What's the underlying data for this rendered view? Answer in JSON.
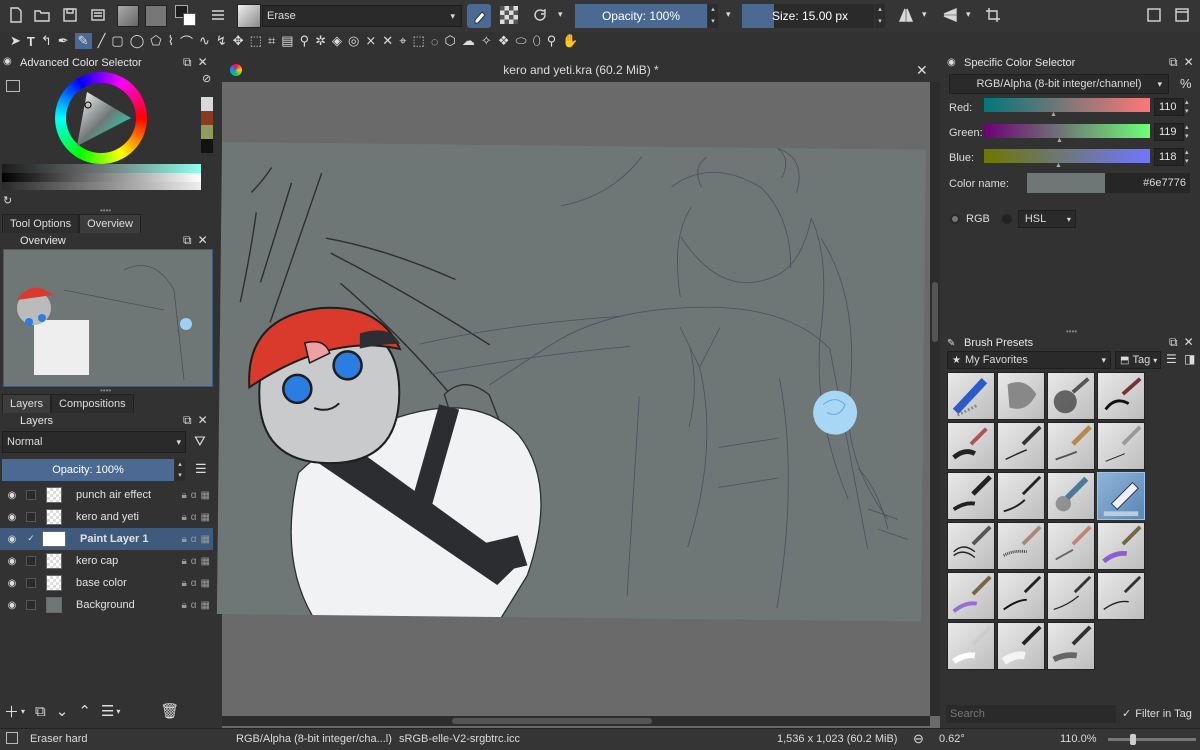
{
  "toolbar": {
    "blend_mode": "Erase",
    "opacity": "Opacity: 100%",
    "size": "Size: 15.00 px"
  },
  "color_selector": {
    "title": "Advanced Color Selector"
  },
  "tabs": {
    "tool_options": "Tool Options",
    "overview": "Overview"
  },
  "overview": {
    "title": "Overview"
  },
  "layer_tabs": {
    "layers": "Layers",
    "compositions": "Compositions"
  },
  "layers_panel": {
    "title": "Layers",
    "blend_mode": "Normal",
    "opacity": "Opacity:  100%",
    "layers": [
      {
        "name": "punch air effect"
      },
      {
        "name": "kero and yeti"
      },
      {
        "name": "Paint Layer 1"
      },
      {
        "name": "kero cap"
      },
      {
        "name": "base color"
      },
      {
        "name": "Background"
      }
    ]
  },
  "canvas": {
    "title": "kero and yeti.kra (60.2 MiB) *"
  },
  "specific_color": {
    "title": "Specific Color Selector",
    "model": "RGB/Alpha (8-bit integer/channel)",
    "percent": "%",
    "red_label": "Red:",
    "red_value": "110",
    "green_label": "Green:",
    "green_value": "119",
    "blue_label": "Blue:",
    "blue_value": "118",
    "color_name_label": "Color name:",
    "color_hex": "#6e7776",
    "rgb_option": "RGB",
    "hsl_option": "HSL"
  },
  "brush_presets": {
    "title": "Brush Presets",
    "tag": "My Favorites",
    "tag_button": "Tag",
    "search_placeholder": "Search",
    "filter_label": "Filter in Tag"
  },
  "statusbar": {
    "tool": "Eraser hard",
    "colorspace": "RGB/Alpha (8-bit integer/cha...l)",
    "profile": "sRGB-elle-V2-srgbtrc.icc",
    "dimensions": "1,536 x 1,023 (60.2 MiB)",
    "rotation": "0.62°",
    "zoom": "110.0%"
  },
  "colors": {
    "accent": "#4a6a93",
    "canvas_bg": "#6e7776",
    "cap_red": "#d93a2c"
  }
}
